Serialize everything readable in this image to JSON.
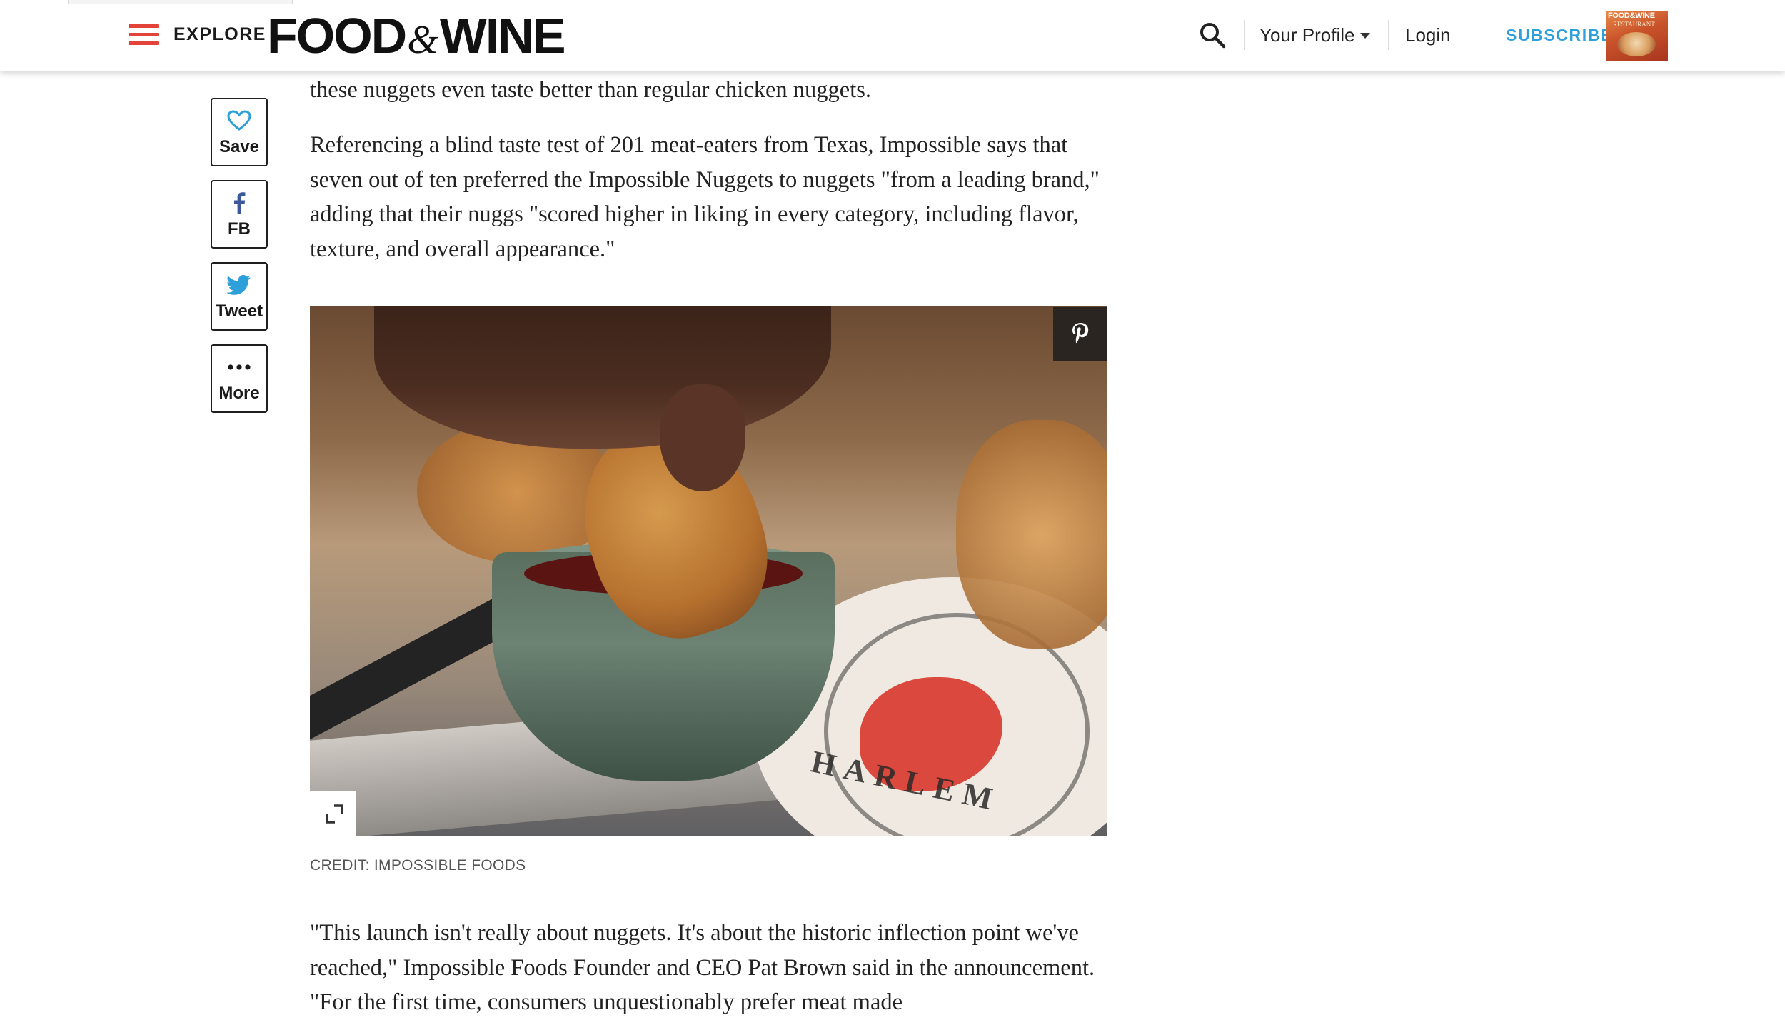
{
  "header": {
    "explore_label": "EXPLORE",
    "logo": {
      "left": "FOOD",
      "amp": "&",
      "right": "WINE"
    },
    "profile_label": "Your Profile",
    "login_label": "Login",
    "subscribe_label": "SUBSCRIBE",
    "magazine_title": "FOOD&WINE",
    "magazine_subtitle": "RESTAURANT",
    "accent_color": "#e4433a",
    "subscribe_color": "#2d9fd9"
  },
  "share": {
    "save_label": "Save",
    "fb_label": "FB",
    "tweet_label": "Tweet",
    "more_label": "More"
  },
  "article": {
    "paragraphs": [
      "these nuggets even taste better than regular chicken nuggets.",
      "Referencing a blind taste test of 201 meat-eaters from Texas, Impossible says that seven out of ten preferred the Impossible Nuggets to nuggets \"from a leading brand,\" adding that their nuggs \"scored higher in liking in every category, including flavor, texture, and overall appearance.\"",
      "\"This launch isn't really about nuggets. It's about the historic inflection point we've reached,\" Impossible Foods Founder and CEO Pat Brown said in the announcement. \"For the first time, consumers unquestionably prefer meat made"
    ],
    "photo": {
      "stamp_text": "HARLEM",
      "credit": "CREDIT: IMPOSSIBLE FOODS"
    }
  },
  "icons": {
    "menu": "hamburger-icon",
    "search": "search-icon",
    "save": "heart-icon",
    "fb": "facebook-icon",
    "tweet": "twitter-icon",
    "more": "ellipsis-icon",
    "pin": "pinterest-icon",
    "expand": "expand-icon"
  }
}
